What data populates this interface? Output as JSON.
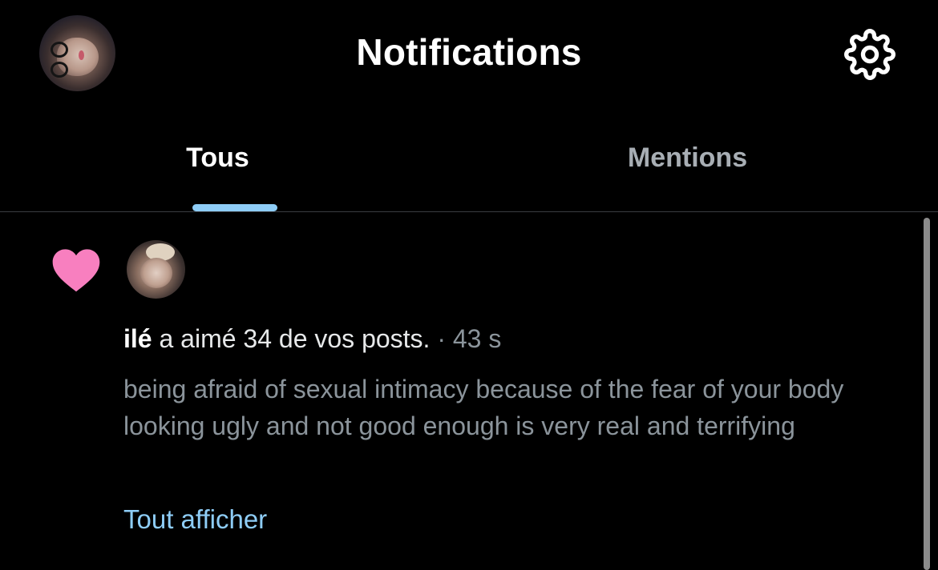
{
  "header": {
    "title": "Notifications",
    "profile_avatar_icon": "profile-photo-icon",
    "settings_icon": "gear-icon"
  },
  "tabs": [
    {
      "label": "Tous",
      "selected": true
    },
    {
      "label": "Mentions",
      "selected": false
    }
  ],
  "notification": {
    "type_icon": "heart-icon",
    "type_icon_color": "#f87fbf",
    "user_name": "ilé",
    "action_text": " a aimé 34 de vos posts.",
    "separator": " · ",
    "time": "43 s",
    "post_text": "being afraid of sexual intimacy because of the fear of your body looking ugly and not good enough is very real and terrifying",
    "show_all_label": "Tout afficher"
  },
  "colors": {
    "background": "#000000",
    "accent": "#8ecdf7",
    "heart": "#f87fbf",
    "muted_text": "#8b949b"
  }
}
